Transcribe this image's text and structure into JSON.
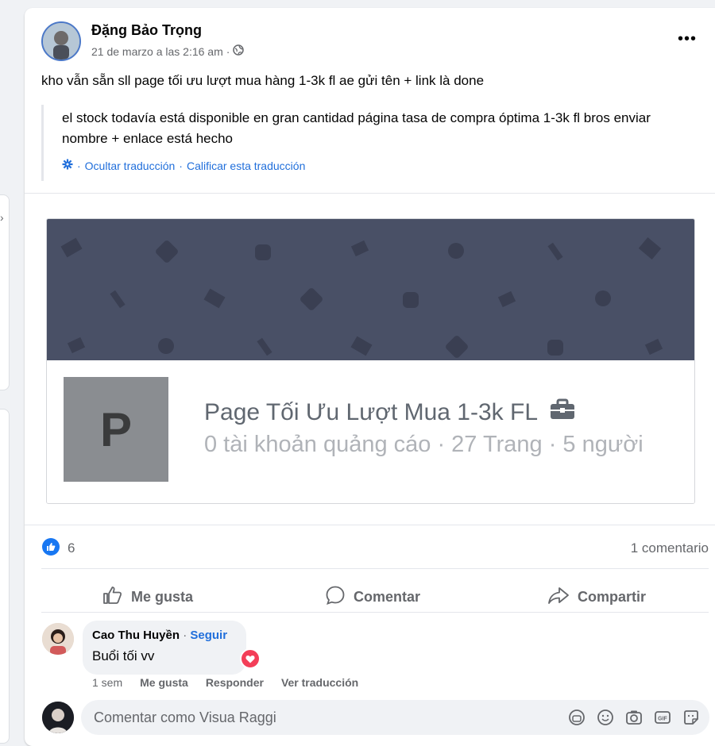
{
  "post": {
    "author": "Đặng Bảo Trọng",
    "timestamp": "21 de marzo a las 2:16 am",
    "separator": "·",
    "more_label": "•••",
    "text": "kho vẫn sẵn sll page tối ưu lượt mua hàng 1-3k fl ae gửi tên + link là done",
    "translation": "el stock todavía está disponible en gran cantidad página tasa de compra óptima 1-3k fl bros enviar nombre + enlace está hecho",
    "translation_links": {
      "hide": "Ocultar traducción",
      "sep": "·",
      "rate": "Calificar esta traducción"
    }
  },
  "preview": {
    "page_initial": "P",
    "page_name": "Page Tối Ưu Lượt Mua 1-3k FL",
    "page_stats": "0 tài khoản quảng cáo · 27 Trang · 5 người"
  },
  "reactions": {
    "like_count": "6",
    "comment_count": "1 comentario"
  },
  "actions": {
    "like": "Me gusta",
    "comment": "Comentar",
    "share": "Compartir"
  },
  "comment": {
    "author": "Cao Thu Huyền",
    "sep": "·",
    "follow": "Seguir",
    "text": "Buổi tối vv",
    "time": "1 sem",
    "like": "Me gusta",
    "reply": "Responder",
    "see_translation": "Ver traducción"
  },
  "composer": {
    "placeholder": "Comentar como Visua Raggi"
  },
  "colors": {
    "accent": "#1877f2",
    "link": "#216fdb",
    "cover": "#495066",
    "heart": "#f33e58"
  }
}
